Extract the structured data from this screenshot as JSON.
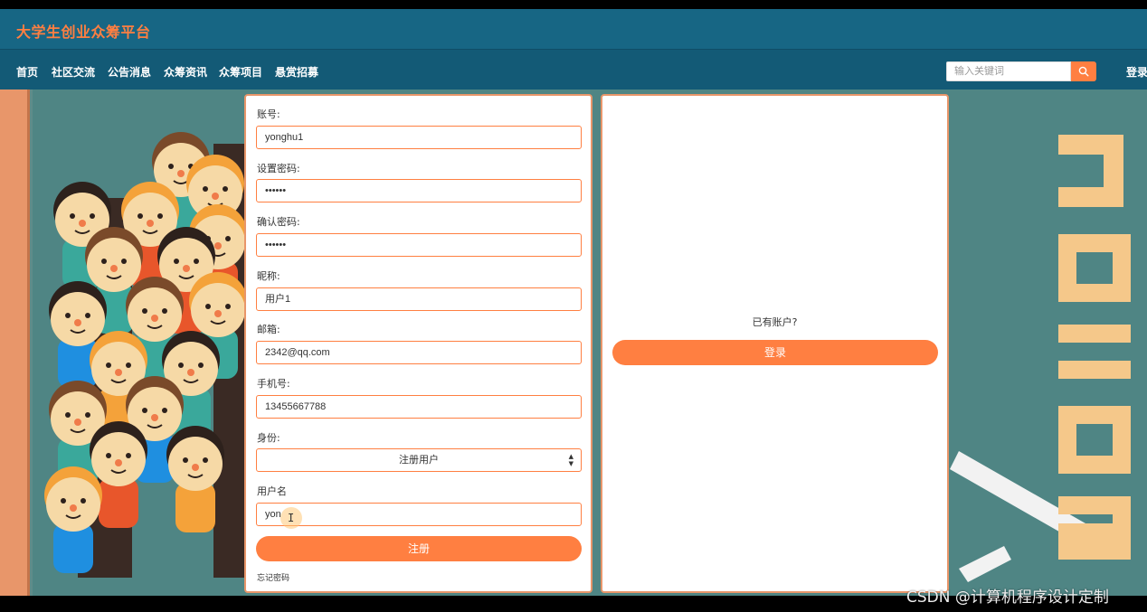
{
  "header": {
    "site_title": "大学生创业众筹平台"
  },
  "nav": {
    "items": [
      "首页",
      "社区交流",
      "公告消息",
      "众筹资讯",
      "众筹项目",
      "悬赏招募"
    ],
    "search_placeholder": "输入关键词",
    "login_label": "登录"
  },
  "register_form": {
    "account_label": "账号:",
    "account_value": "yonghu1",
    "password_label": "设置密码:",
    "password_value": "••••••",
    "confirm_label": "确认密码:",
    "confirm_value": "••••••",
    "nickname_label": "昵称:",
    "nickname_value": "用户1",
    "email_label": "邮箱:",
    "email_value": "2342@qq.com",
    "phone_label": "手机号:",
    "phone_value": "13455667788",
    "role_label": "身份:",
    "role_value": "注册用户",
    "username_label": "用户名",
    "username_value": "yon",
    "submit_label": "注册",
    "forgot_label": "忘记密码"
  },
  "login_panel": {
    "question": "已有账户?",
    "login_button": "登录"
  },
  "watermark": "CSDN @计算机程序设计定制",
  "colors": {
    "accent": "#ff7f41",
    "header": "#176684",
    "navbar": "#135a76"
  }
}
